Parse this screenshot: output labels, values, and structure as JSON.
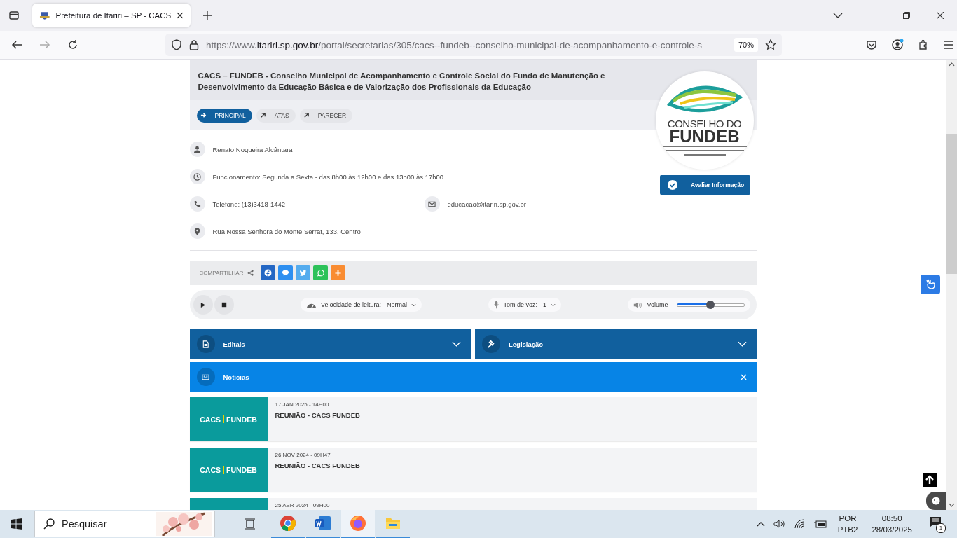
{
  "browser": {
    "tab_title": "Prefeitura de Itariri – SP - CACS",
    "url_scheme": "https://www.",
    "url_domain": "itariri.sp.gov.br",
    "url_path": "/portal/secretarias/305/cacs--fundeb--conselho-municipal-de-acompanhamento-e-controle-s",
    "zoom": "70%"
  },
  "page": {
    "title": "CACS – FUNDEB - Conselho Municipal de Acompanhamento e Controle Social do Fundo de Manutenção e Desenvolvimento da Educação Básica e de Valorização dos Profissionais da Educação",
    "tabs": [
      {
        "label": "PRINCIPAL",
        "selected": true
      },
      {
        "label": "ATAS",
        "selected": false
      },
      {
        "label": "PARECER",
        "selected": false
      }
    ],
    "logo": {
      "line1": "CONSELHO DO",
      "line2": "FUNDEB"
    },
    "rate_button": "Avaliar Informação",
    "contacts": [
      {
        "kind": "person",
        "text": "Renato Noqueira Alcântara"
      },
      {
        "kind": "clock",
        "text": "Funcionamento: Segunda a Sexta - das 8h00 às 12h00 e das 13h00 às 17h00"
      },
      {
        "kind": "phone",
        "text": "Telefone: (13)3418-1442"
      },
      {
        "kind": "email",
        "text": "educacao@itariri.sp.gov.br"
      },
      {
        "kind": "pin",
        "text": "Rua Nossa Senhora do Monte Serrat, 133, Centro"
      }
    ],
    "share": {
      "label": "COMPARTILHAR",
      "buttons": [
        {
          "kind": "facebook"
        },
        {
          "kind": "chat"
        },
        {
          "kind": "twitter"
        },
        {
          "kind": "whatsapp"
        },
        {
          "kind": "more"
        }
      ]
    },
    "player": {
      "speed_label": "Velocidade de leitura:",
      "speed_value": "Normal",
      "voice_label": "Tom de voz:",
      "voice_value": "1",
      "volume_label": "Volume",
      "volume": {
        "level": 0.49
      }
    },
    "sections": [
      {
        "kind": "document",
        "title": "Editais",
        "expanded": false
      },
      {
        "kind": "gavel",
        "title": "Legislação",
        "expanded": false
      },
      {
        "kind": "news",
        "title": "Notícias",
        "expanded": true
      }
    ],
    "news": [
      {
        "date": "17 JAN 2025 - 14H00",
        "title": "REUNIÃO - CACS FUNDEB",
        "thumb_left": "CACS",
        "thumb_right": "FUNDEB"
      },
      {
        "date": "26 NOV 2024 - 09H47",
        "title": "REUNIÃO - CACS FUNDEB",
        "thumb_left": "CACS",
        "thumb_right": "FUNDEB"
      },
      {
        "date": "25 ABR 2024 - 09H00"
      }
    ]
  },
  "taskbar": {
    "search_placeholder": "Pesquisar",
    "lang": "POR",
    "layout": "PTB2",
    "time": "08:50",
    "date": "28/03/2025",
    "notifications": "1"
  }
}
